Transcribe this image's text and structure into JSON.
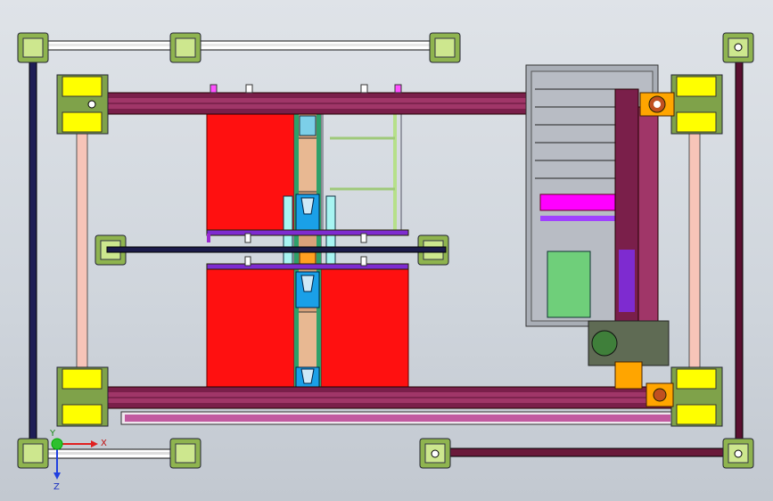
{
  "view": {
    "axes": {
      "x_label": "X",
      "y_label": "Y",
      "z_label": "Z"
    }
  },
  "colors": {
    "background": "#d4d9df",
    "frame_rail": "#2a2a5a",
    "gantry_beam": "#7a1f4a",
    "gantry_beam_inner": "#a02a60",
    "yellow_block": "#ffff00",
    "green_block": "#7fa24a",
    "red_panel": "#ff1010",
    "magenta": "#ff00ff",
    "cyan": "#8ff0f0",
    "tan": "#e0b088",
    "green_panel": "#6fcf7a",
    "purple": "#8a2be2",
    "orange": "#ffa500"
  }
}
